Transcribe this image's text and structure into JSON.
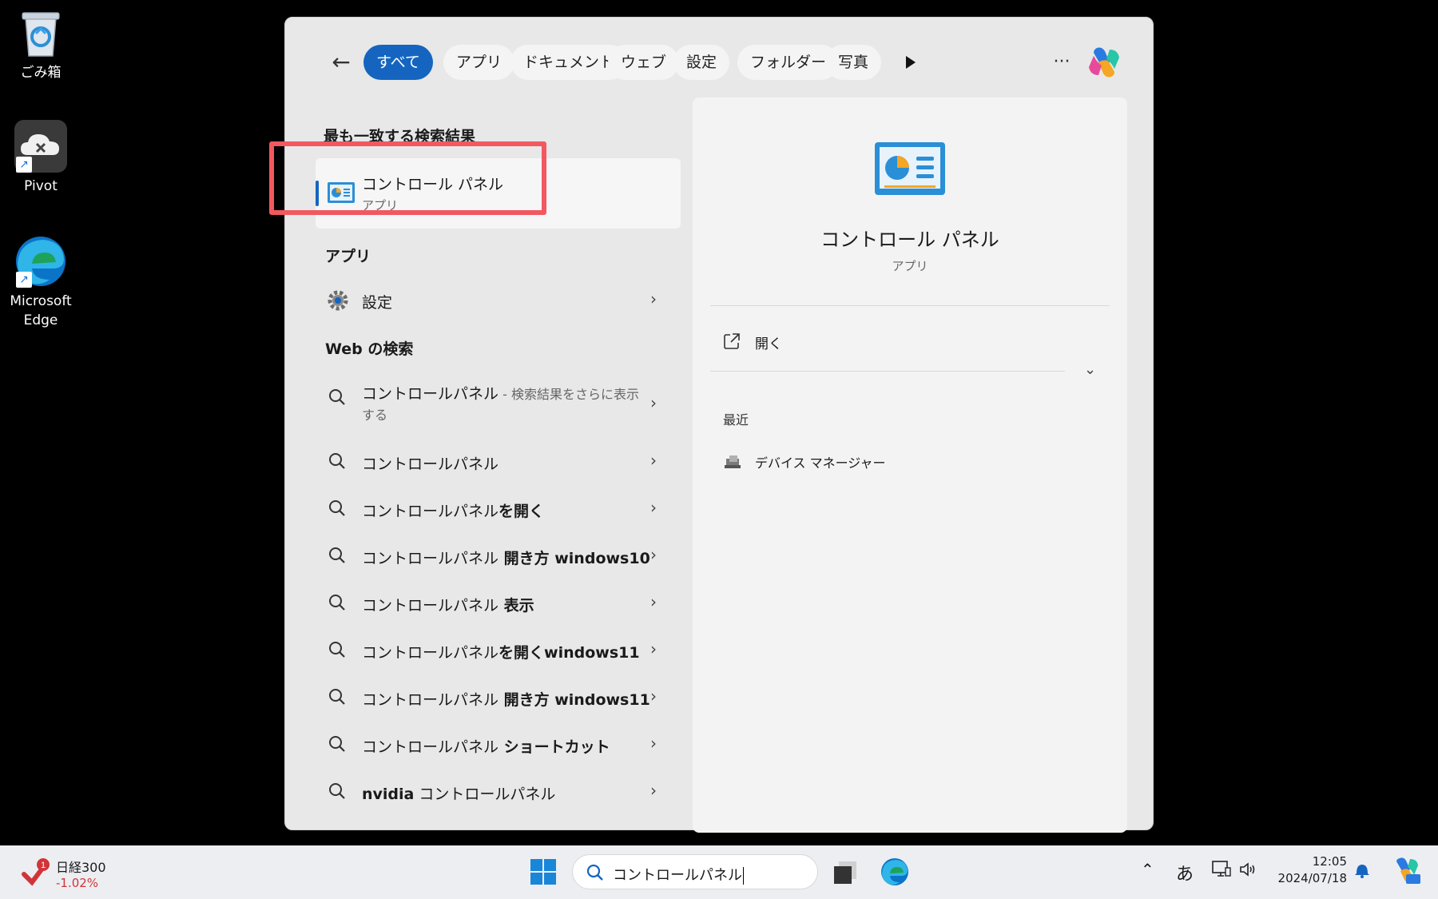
{
  "desktop": {
    "icons": [
      {
        "label": "ごみ箱"
      },
      {
        "label": "Pivot"
      },
      {
        "label": "Microsoft Edge"
      }
    ]
  },
  "search_panel": {
    "filters": [
      {
        "label": "すべて",
        "active": true
      },
      {
        "label": "アプリ"
      },
      {
        "label": "ドキュメント"
      },
      {
        "label": "ウェブ"
      },
      {
        "label": "設定"
      },
      {
        "label": "フォルダー"
      },
      {
        "label": "写真"
      }
    ],
    "more_label": "···",
    "best_match": {
      "section_title": "最も一致する検索結果",
      "name": "コントロール パネル",
      "type": "アプリ"
    },
    "apps": {
      "section_title": "アプリ",
      "items": [
        {
          "label": "設定"
        }
      ]
    },
    "web": {
      "section_title": "Web の検索",
      "first": {
        "label": "コントロールパネル",
        "sub": " - 検索結果をさらに表示",
        "sub2": "する"
      },
      "items": [
        {
          "base": "コントロールパネル",
          "bold": ""
        },
        {
          "base": "コントロールパネル",
          "bold": "を開く"
        },
        {
          "base": "コントロールパネル",
          "bold": " 開き方 windows10"
        },
        {
          "base": "コントロールパネル",
          "bold": " 表示"
        },
        {
          "base": "コントロールパネル",
          "bold": "を開くwindows11"
        },
        {
          "base": "コントロールパネル",
          "bold": " 開き方 windows11"
        },
        {
          "base": "コントロールパネル",
          "bold": " ショートカット"
        },
        {
          "prefix": "nvidia",
          "base": " コントロールパネル",
          "bold": ""
        }
      ]
    },
    "detail": {
      "title": "コントロール パネル",
      "type": "アプリ",
      "open_label": "開く",
      "recent_title": "最近",
      "recent_items": [
        {
          "label": "デバイス マネージャー"
        }
      ]
    }
  },
  "taskbar": {
    "weather": {
      "title": "日経300",
      "change": "-1.02%",
      "badge": "1"
    },
    "search_value": "コントロールパネル",
    "ime": "あ",
    "clock": {
      "time": "12:05",
      "date": "2024/07/18"
    }
  },
  "colors": {
    "accent": "#1565c0",
    "highlight_box": "#f25860",
    "negative": "#d13438"
  }
}
